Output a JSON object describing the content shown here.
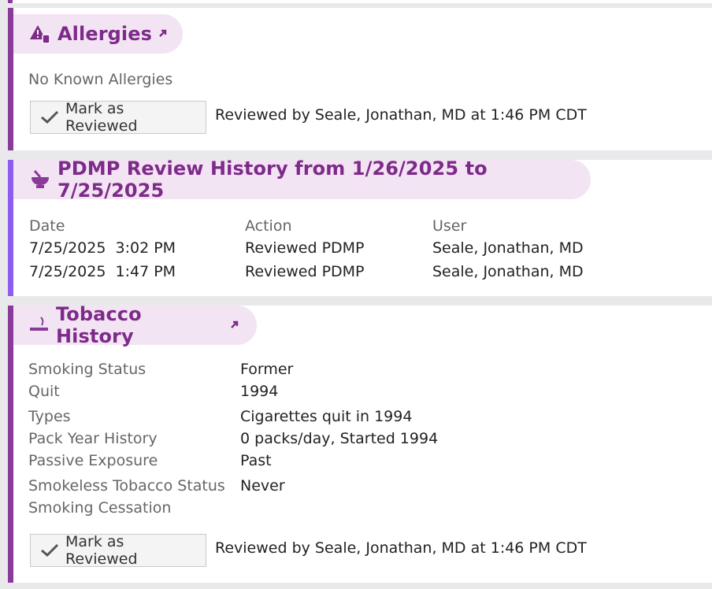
{
  "allergies": {
    "title": "Allergies",
    "status": "No Known Allergies",
    "mark_button": "Mark as Reviewed",
    "reviewed_text": "Reviewed by Seale, Jonathan, MD at 1:46 PM CDT",
    "icon": "allergy-warning-icon"
  },
  "pdmp": {
    "title": "PDMP Review History from 1/26/2025 to 7/25/2025",
    "icon": "mortar-pestle-icon",
    "headers": [
      "Date",
      "Action",
      "User"
    ],
    "rows": [
      {
        "date": "7/25/2025  3:02 PM",
        "action": "Reviewed PDMP",
        "user": "Seale, Jonathan, MD"
      },
      {
        "date": "7/25/2025  1:47 PM",
        "action": "Reviewed PDMP",
        "user": "Seale, Jonathan, MD"
      }
    ]
  },
  "tobacco": {
    "title": "Tobacco History",
    "icon": "cigarette-icon",
    "fields": [
      {
        "label": "Smoking Status",
        "value": "Former"
      },
      {
        "label": "Quit",
        "value": "1994"
      },
      {
        "label": "Types",
        "value": "Cigarettes quit in 1994"
      },
      {
        "label": "Pack Year History",
        "value": "0 packs/day, Started 1994"
      },
      {
        "label": "Passive Exposure",
        "value": "Past"
      },
      {
        "label": "Smokeless Tobacco Status",
        "value": "Never"
      },
      {
        "label": "Smoking Cessation",
        "value": ""
      }
    ],
    "mark_button": "Mark as Reviewed",
    "reviewed_text": "Reviewed by Seale, Jonathan, MD at 1:46 PM CDT"
  },
  "colors": {
    "accent": "#7e2a8a",
    "pdmp_accent": "#8f5cf2",
    "pill_bg": "#f2e4f3"
  }
}
